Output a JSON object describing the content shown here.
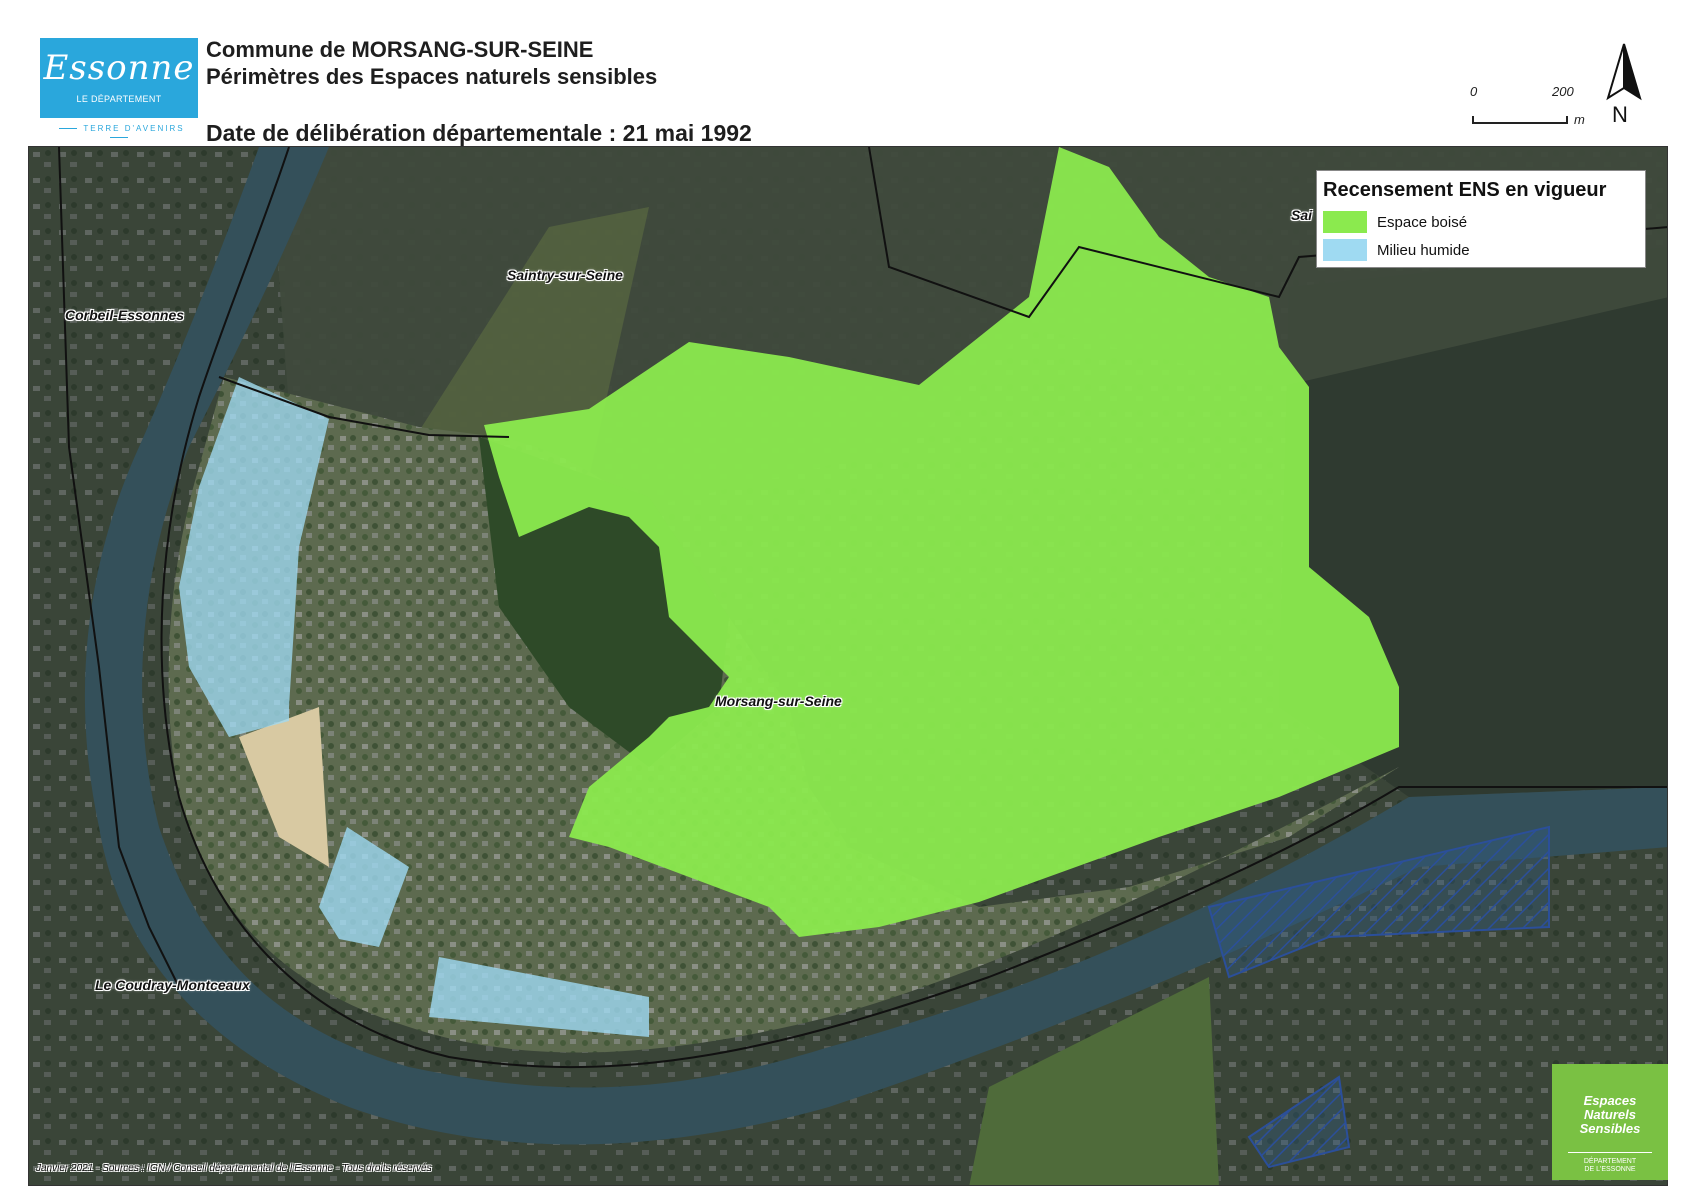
{
  "header": {
    "title_line1": "Commune de MORSANG-SUR-SEINE",
    "title_line2": "Périmètres des Espaces naturels sensibles",
    "date_line": "Date de délibération départementale : 21 mai 1992"
  },
  "logo": {
    "script": "Essonne",
    "sub": "LE DÉPARTEMENT",
    "tagline": "TERRE D'AVENIRS",
    "color": "#2aa7dc"
  },
  "scale_bar": {
    "label_start": "0",
    "label_end": "200",
    "unit": "m"
  },
  "north_arrow": {
    "label": "N"
  },
  "legend": {
    "title": "Recensement ENS en vigueur",
    "items": [
      {
        "label": "Espace boisé",
        "color": "#8bea4e"
      },
      {
        "label": "Milieu humide",
        "color": "#9fdaf2"
      }
    ]
  },
  "places": {
    "saintry": "Saintry-sur-Seine",
    "corbeil": "Corbeil-Essonnes",
    "morsang": "Morsang-sur-Seine",
    "coudray": "Le Coudray-Montceaux",
    "partial_top_right": "Sai"
  },
  "credits": "Janvier 2021 - Sources : IGN / Conseil départemental de l'Essonne - Tous droits réservés",
  "ens_logo": {
    "line1": "Espaces",
    "line2": "Naturels",
    "line3": "Sensibles",
    "sub1": "DÉPARTEMENT",
    "sub2": "DE L'ESSONNE",
    "color": "#7ac143"
  }
}
